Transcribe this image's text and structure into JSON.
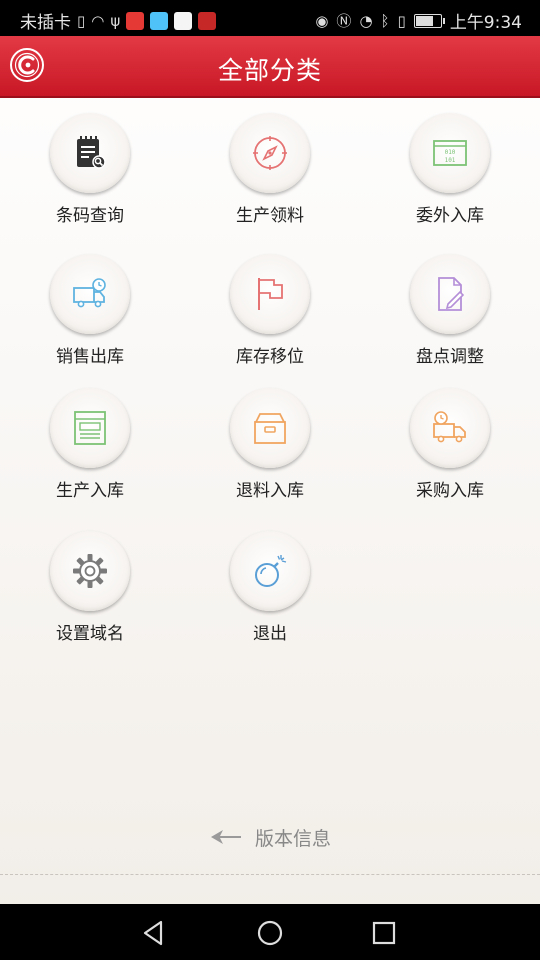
{
  "status_bar": {
    "carrier": "未插卡",
    "time": "上午9:34",
    "battery_level": 0.8
  },
  "header": {
    "title": "全部分类",
    "logo_icon": "app-logo-icon"
  },
  "menu_items": [
    {
      "label": "条码查询",
      "icon": "barcode-search-icon",
      "color": "#333333"
    },
    {
      "label": "生产领料",
      "icon": "compass-icon",
      "color": "#e57373"
    },
    {
      "label": "委外入库",
      "icon": "binary-panel-icon",
      "color": "#7cc276"
    },
    {
      "label": "销售出库",
      "icon": "delivery-truck-clock-icon",
      "color": "#5fb3e0"
    },
    {
      "label": "库存移位",
      "icon": "flag-icon",
      "color": "#e57373"
    },
    {
      "label": "盘点调整",
      "icon": "document-edit-icon",
      "color": "#b48fd8"
    },
    {
      "label": "生产入库",
      "icon": "form-panel-icon",
      "color": "#7cc276"
    },
    {
      "label": "退料入库",
      "icon": "box-icon",
      "color": "#f0a560"
    },
    {
      "label": "采购入库",
      "icon": "truck-clock-icon",
      "color": "#f0a560"
    },
    {
      "label": "设置域名",
      "icon": "gear-icon",
      "color": "#7a7a7a"
    },
    {
      "label": "退出",
      "icon": "bomb-icon",
      "color": "#5a9fd6"
    }
  ],
  "footer": {
    "version_label": "版本信息"
  }
}
